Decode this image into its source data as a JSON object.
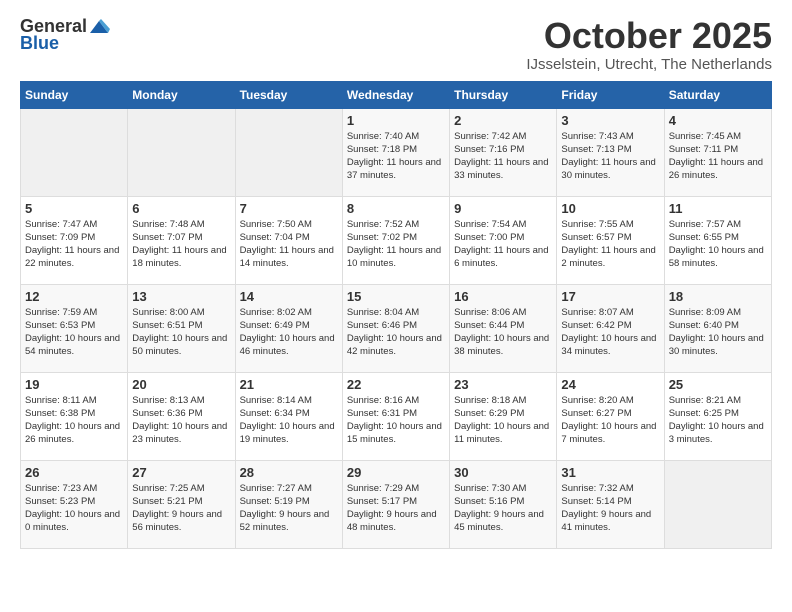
{
  "header": {
    "logo_general": "General",
    "logo_blue": "Blue",
    "month": "October 2025",
    "location": "IJsselstein, Utrecht, The Netherlands"
  },
  "weekdays": [
    "Sunday",
    "Monday",
    "Tuesday",
    "Wednesday",
    "Thursday",
    "Friday",
    "Saturday"
  ],
  "weeks": [
    [
      {
        "day": "",
        "empty": true
      },
      {
        "day": "",
        "empty": true
      },
      {
        "day": "",
        "empty": true
      },
      {
        "day": "1",
        "sunrise": "Sunrise: 7:40 AM",
        "sunset": "Sunset: 7:18 PM",
        "daylight": "Daylight: 11 hours and 37 minutes."
      },
      {
        "day": "2",
        "sunrise": "Sunrise: 7:42 AM",
        "sunset": "Sunset: 7:16 PM",
        "daylight": "Daylight: 11 hours and 33 minutes."
      },
      {
        "day": "3",
        "sunrise": "Sunrise: 7:43 AM",
        "sunset": "Sunset: 7:13 PM",
        "daylight": "Daylight: 11 hours and 30 minutes."
      },
      {
        "day": "4",
        "sunrise": "Sunrise: 7:45 AM",
        "sunset": "Sunset: 7:11 PM",
        "daylight": "Daylight: 11 hours and 26 minutes."
      }
    ],
    [
      {
        "day": "5",
        "sunrise": "Sunrise: 7:47 AM",
        "sunset": "Sunset: 7:09 PM",
        "daylight": "Daylight: 11 hours and 22 minutes."
      },
      {
        "day": "6",
        "sunrise": "Sunrise: 7:48 AM",
        "sunset": "Sunset: 7:07 PM",
        "daylight": "Daylight: 11 hours and 18 minutes."
      },
      {
        "day": "7",
        "sunrise": "Sunrise: 7:50 AM",
        "sunset": "Sunset: 7:04 PM",
        "daylight": "Daylight: 11 hours and 14 minutes."
      },
      {
        "day": "8",
        "sunrise": "Sunrise: 7:52 AM",
        "sunset": "Sunset: 7:02 PM",
        "daylight": "Daylight: 11 hours and 10 minutes."
      },
      {
        "day": "9",
        "sunrise": "Sunrise: 7:54 AM",
        "sunset": "Sunset: 7:00 PM",
        "daylight": "Daylight: 11 hours and 6 minutes."
      },
      {
        "day": "10",
        "sunrise": "Sunrise: 7:55 AM",
        "sunset": "Sunset: 6:57 PM",
        "daylight": "Daylight: 11 hours and 2 minutes."
      },
      {
        "day": "11",
        "sunrise": "Sunrise: 7:57 AM",
        "sunset": "Sunset: 6:55 PM",
        "daylight": "Daylight: 10 hours and 58 minutes."
      }
    ],
    [
      {
        "day": "12",
        "sunrise": "Sunrise: 7:59 AM",
        "sunset": "Sunset: 6:53 PM",
        "daylight": "Daylight: 10 hours and 54 minutes."
      },
      {
        "day": "13",
        "sunrise": "Sunrise: 8:00 AM",
        "sunset": "Sunset: 6:51 PM",
        "daylight": "Daylight: 10 hours and 50 minutes."
      },
      {
        "day": "14",
        "sunrise": "Sunrise: 8:02 AM",
        "sunset": "Sunset: 6:49 PM",
        "daylight": "Daylight: 10 hours and 46 minutes."
      },
      {
        "day": "15",
        "sunrise": "Sunrise: 8:04 AM",
        "sunset": "Sunset: 6:46 PM",
        "daylight": "Daylight: 10 hours and 42 minutes."
      },
      {
        "day": "16",
        "sunrise": "Sunrise: 8:06 AM",
        "sunset": "Sunset: 6:44 PM",
        "daylight": "Daylight: 10 hours and 38 minutes."
      },
      {
        "day": "17",
        "sunrise": "Sunrise: 8:07 AM",
        "sunset": "Sunset: 6:42 PM",
        "daylight": "Daylight: 10 hours and 34 minutes."
      },
      {
        "day": "18",
        "sunrise": "Sunrise: 8:09 AM",
        "sunset": "Sunset: 6:40 PM",
        "daylight": "Daylight: 10 hours and 30 minutes."
      }
    ],
    [
      {
        "day": "19",
        "sunrise": "Sunrise: 8:11 AM",
        "sunset": "Sunset: 6:38 PM",
        "daylight": "Daylight: 10 hours and 26 minutes."
      },
      {
        "day": "20",
        "sunrise": "Sunrise: 8:13 AM",
        "sunset": "Sunset: 6:36 PM",
        "daylight": "Daylight: 10 hours and 23 minutes."
      },
      {
        "day": "21",
        "sunrise": "Sunrise: 8:14 AM",
        "sunset": "Sunset: 6:34 PM",
        "daylight": "Daylight: 10 hours and 19 minutes."
      },
      {
        "day": "22",
        "sunrise": "Sunrise: 8:16 AM",
        "sunset": "Sunset: 6:31 PM",
        "daylight": "Daylight: 10 hours and 15 minutes."
      },
      {
        "day": "23",
        "sunrise": "Sunrise: 8:18 AM",
        "sunset": "Sunset: 6:29 PM",
        "daylight": "Daylight: 10 hours and 11 minutes."
      },
      {
        "day": "24",
        "sunrise": "Sunrise: 8:20 AM",
        "sunset": "Sunset: 6:27 PM",
        "daylight": "Daylight: 10 hours and 7 minutes."
      },
      {
        "day": "25",
        "sunrise": "Sunrise: 8:21 AM",
        "sunset": "Sunset: 6:25 PM",
        "daylight": "Daylight: 10 hours and 3 minutes."
      }
    ],
    [
      {
        "day": "26",
        "sunrise": "Sunrise: 7:23 AM",
        "sunset": "Sunset: 5:23 PM",
        "daylight": "Daylight: 10 hours and 0 minutes."
      },
      {
        "day": "27",
        "sunrise": "Sunrise: 7:25 AM",
        "sunset": "Sunset: 5:21 PM",
        "daylight": "Daylight: 9 hours and 56 minutes."
      },
      {
        "day": "28",
        "sunrise": "Sunrise: 7:27 AM",
        "sunset": "Sunset: 5:19 PM",
        "daylight": "Daylight: 9 hours and 52 minutes."
      },
      {
        "day": "29",
        "sunrise": "Sunrise: 7:29 AM",
        "sunset": "Sunset: 5:17 PM",
        "daylight": "Daylight: 9 hours and 48 minutes."
      },
      {
        "day": "30",
        "sunrise": "Sunrise: 7:30 AM",
        "sunset": "Sunset: 5:16 PM",
        "daylight": "Daylight: 9 hours and 45 minutes."
      },
      {
        "day": "31",
        "sunrise": "Sunrise: 7:32 AM",
        "sunset": "Sunset: 5:14 PM",
        "daylight": "Daylight: 9 hours and 41 minutes."
      },
      {
        "day": "",
        "empty": true
      }
    ]
  ]
}
